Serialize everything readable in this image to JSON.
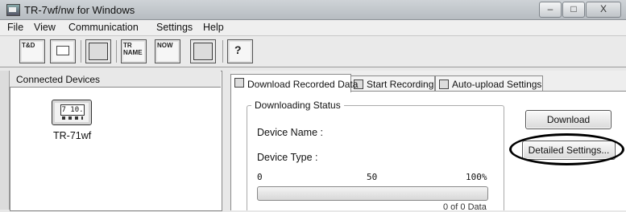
{
  "window": {
    "title": "TR-7wf/nw for Windows",
    "controls": {
      "minimize": "–",
      "maximize": "□",
      "close": "X"
    }
  },
  "menu": [
    {
      "label": "File"
    },
    {
      "label": "View"
    },
    {
      "label": "Communication"
    },
    {
      "label": "Settings"
    },
    {
      "label": "Help"
    }
  ],
  "toolbar": {
    "buttons": [
      {
        "name": "tandd-button",
        "text": "T&D"
      },
      {
        "name": "window-button",
        "text": ""
      },
      {
        "name": "grid-button",
        "text": ""
      },
      {
        "name": "tr-name-button",
        "text": "TR NAME"
      },
      {
        "name": "now-button",
        "text": "NOW"
      },
      {
        "name": "layout-button",
        "text": ""
      },
      {
        "name": "help-cursor-button",
        "text": "?"
      }
    ]
  },
  "connected_devices": {
    "header": "Connected Devices",
    "devices": [
      {
        "name": "TR-71wf",
        "display": "7 10."
      }
    ]
  },
  "tabs": [
    {
      "label": "Download Recorded Data",
      "active": true
    },
    {
      "label": "Start Recording",
      "active": false
    },
    {
      "label": "Auto-upload Settings",
      "active": false
    }
  ],
  "downloading_status": {
    "title": "Downloading Status",
    "device_name_label": "Device Name :",
    "device_type_label": "Device Type :",
    "scale": {
      "min": "0",
      "mid": "50",
      "max": "100%"
    },
    "progress": 0,
    "progress_text": "0 of 0 Data"
  },
  "buttons": {
    "download": "Download",
    "detailed_settings": "Detailed Settings..."
  }
}
